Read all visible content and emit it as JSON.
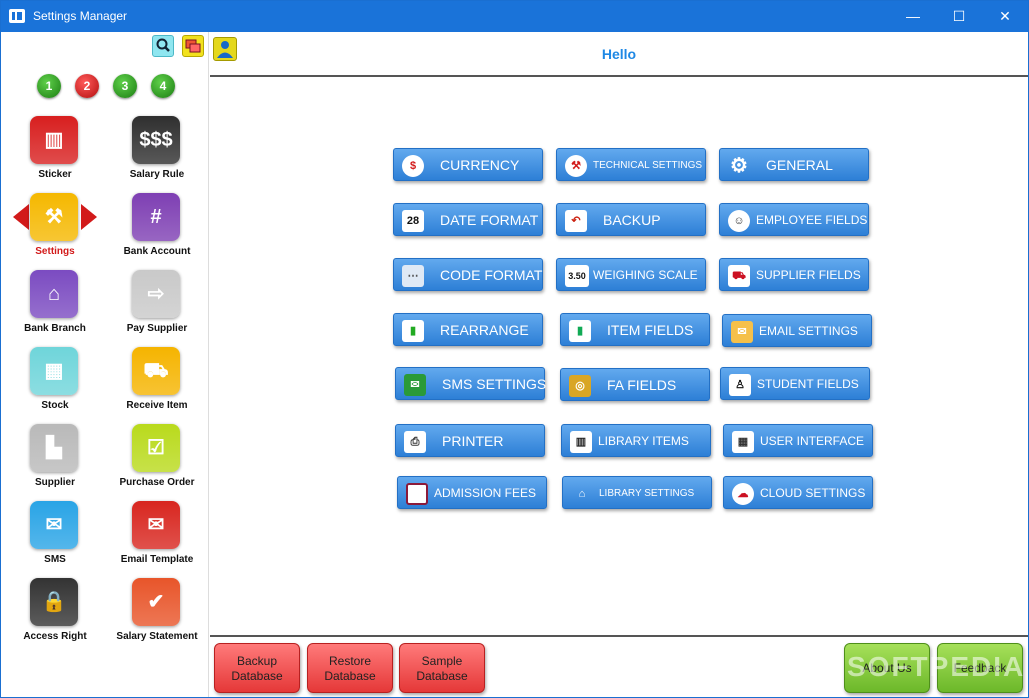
{
  "window": {
    "title": "Settings Manager",
    "minimize": "—",
    "maximize": "☐",
    "close": "✕"
  },
  "sidebar": {
    "tools": {
      "search_icon": "search-icon",
      "windows_icon": "windows-icon"
    },
    "pages": [
      "1",
      "2",
      "3",
      "4"
    ],
    "tiles": [
      {
        "label": "Sticker",
        "icon": "barcode-icon",
        "color": "#d81f1f",
        "glyph": "▥"
      },
      {
        "label": "Salary Rule",
        "icon": "dollar-icon",
        "color": "#2f2f2f",
        "glyph": "$$$"
      },
      {
        "label": "Settings",
        "icon": "tools-icon",
        "color": "#f5b800",
        "glyph": "⚒",
        "active": true
      },
      {
        "label": "Bank Account",
        "icon": "bank-card-icon",
        "color": "#7e3fb3",
        "glyph": "#"
      },
      {
        "label": "Bank Branch",
        "icon": "bank-icon",
        "color": "#7b4bc1",
        "glyph": "⌂"
      },
      {
        "label": "Pay Supplier",
        "icon": "factory-arrow-icon",
        "color": "#c9c9c9",
        "glyph": "⇨"
      },
      {
        "label": "Stock",
        "icon": "cart-icon",
        "color": "#6fd5da",
        "glyph": "▦"
      },
      {
        "label": "Receive Item",
        "icon": "truck-icon",
        "color": "#f5b400",
        "glyph": "⛟"
      },
      {
        "label": "Supplier",
        "icon": "factory-icon",
        "color": "#b9b9b9",
        "glyph": "▙"
      },
      {
        "label": "Purchase Order",
        "icon": "checklist-icon",
        "color": "#b9da1c",
        "glyph": "☑"
      },
      {
        "label": "SMS",
        "icon": "sms-icon",
        "color": "#29a4e6",
        "glyph": "✉"
      },
      {
        "label": "Email Template",
        "icon": "email-icon",
        "color": "#d8261f",
        "glyph": "✉"
      },
      {
        "label": "Access Right",
        "icon": "lock-key-icon",
        "color": "#333333",
        "glyph": "🔒"
      },
      {
        "label": "Salary Statement",
        "icon": "calendar-check-icon",
        "color": "#e8552a",
        "glyph": "✔"
      }
    ]
  },
  "main": {
    "greeting": "Hello",
    "buttons": [
      {
        "label": "CURRENCY",
        "icon": "currency-icon"
      },
      {
        "label": "TECHNICAL SETTINGS",
        "icon": "technical-icon"
      },
      {
        "label": "GENERAL",
        "icon": "gear-icon"
      },
      {
        "label": "DATE FORMAT",
        "icon": "calendar-icon"
      },
      {
        "label": "BACKUP",
        "icon": "backup-icon"
      },
      {
        "label": "EMPLOYEE FIELDS",
        "icon": "employee-icon"
      },
      {
        "label": "CODE FORMAT",
        "icon": "code-format-icon"
      },
      {
        "label": "WEIGHING SCALE",
        "icon": "scale-icon"
      },
      {
        "label": "SUPPLIER FIELDS",
        "icon": "truck-icon"
      },
      {
        "label": "REARRANGE",
        "icon": "rearrange-icon"
      },
      {
        "label": "ITEM FIELDS",
        "icon": "items-icon"
      },
      {
        "label": "EMAIL SETTINGS",
        "icon": "email-icon"
      },
      {
        "label": "SMS SETTINGS",
        "icon": "sms-icon"
      },
      {
        "label": "FA FIELDS",
        "icon": "coins-icon"
      },
      {
        "label": "STUDENT FIELDS",
        "icon": "student-icon"
      },
      {
        "label": "PRINTER",
        "icon": "printer-icon"
      },
      {
        "label": "LIBRARY ITEMS",
        "icon": "books-icon"
      },
      {
        "label": "USER INTERFACE",
        "icon": "ui-icon"
      },
      {
        "label": "ADMISSION FEES",
        "icon": "admission-icon"
      },
      {
        "label": "LIBRARY  SETTINGS",
        "icon": "library-icon"
      },
      {
        "label": "CLOUD SETTINGS",
        "icon": "cloud-icon"
      }
    ],
    "icon_text": {
      "date": "28",
      "scale": "3.50"
    }
  },
  "footer": {
    "backup": {
      "line1": "Backup",
      "line2": "Database"
    },
    "restore": {
      "line1": "Restore",
      "line2": "Database"
    },
    "sample": {
      "line1": "Sample",
      "line2": "Database"
    },
    "about": "About Us",
    "feedback": "Feedback"
  },
  "watermark": "SOFTPEDIA"
}
